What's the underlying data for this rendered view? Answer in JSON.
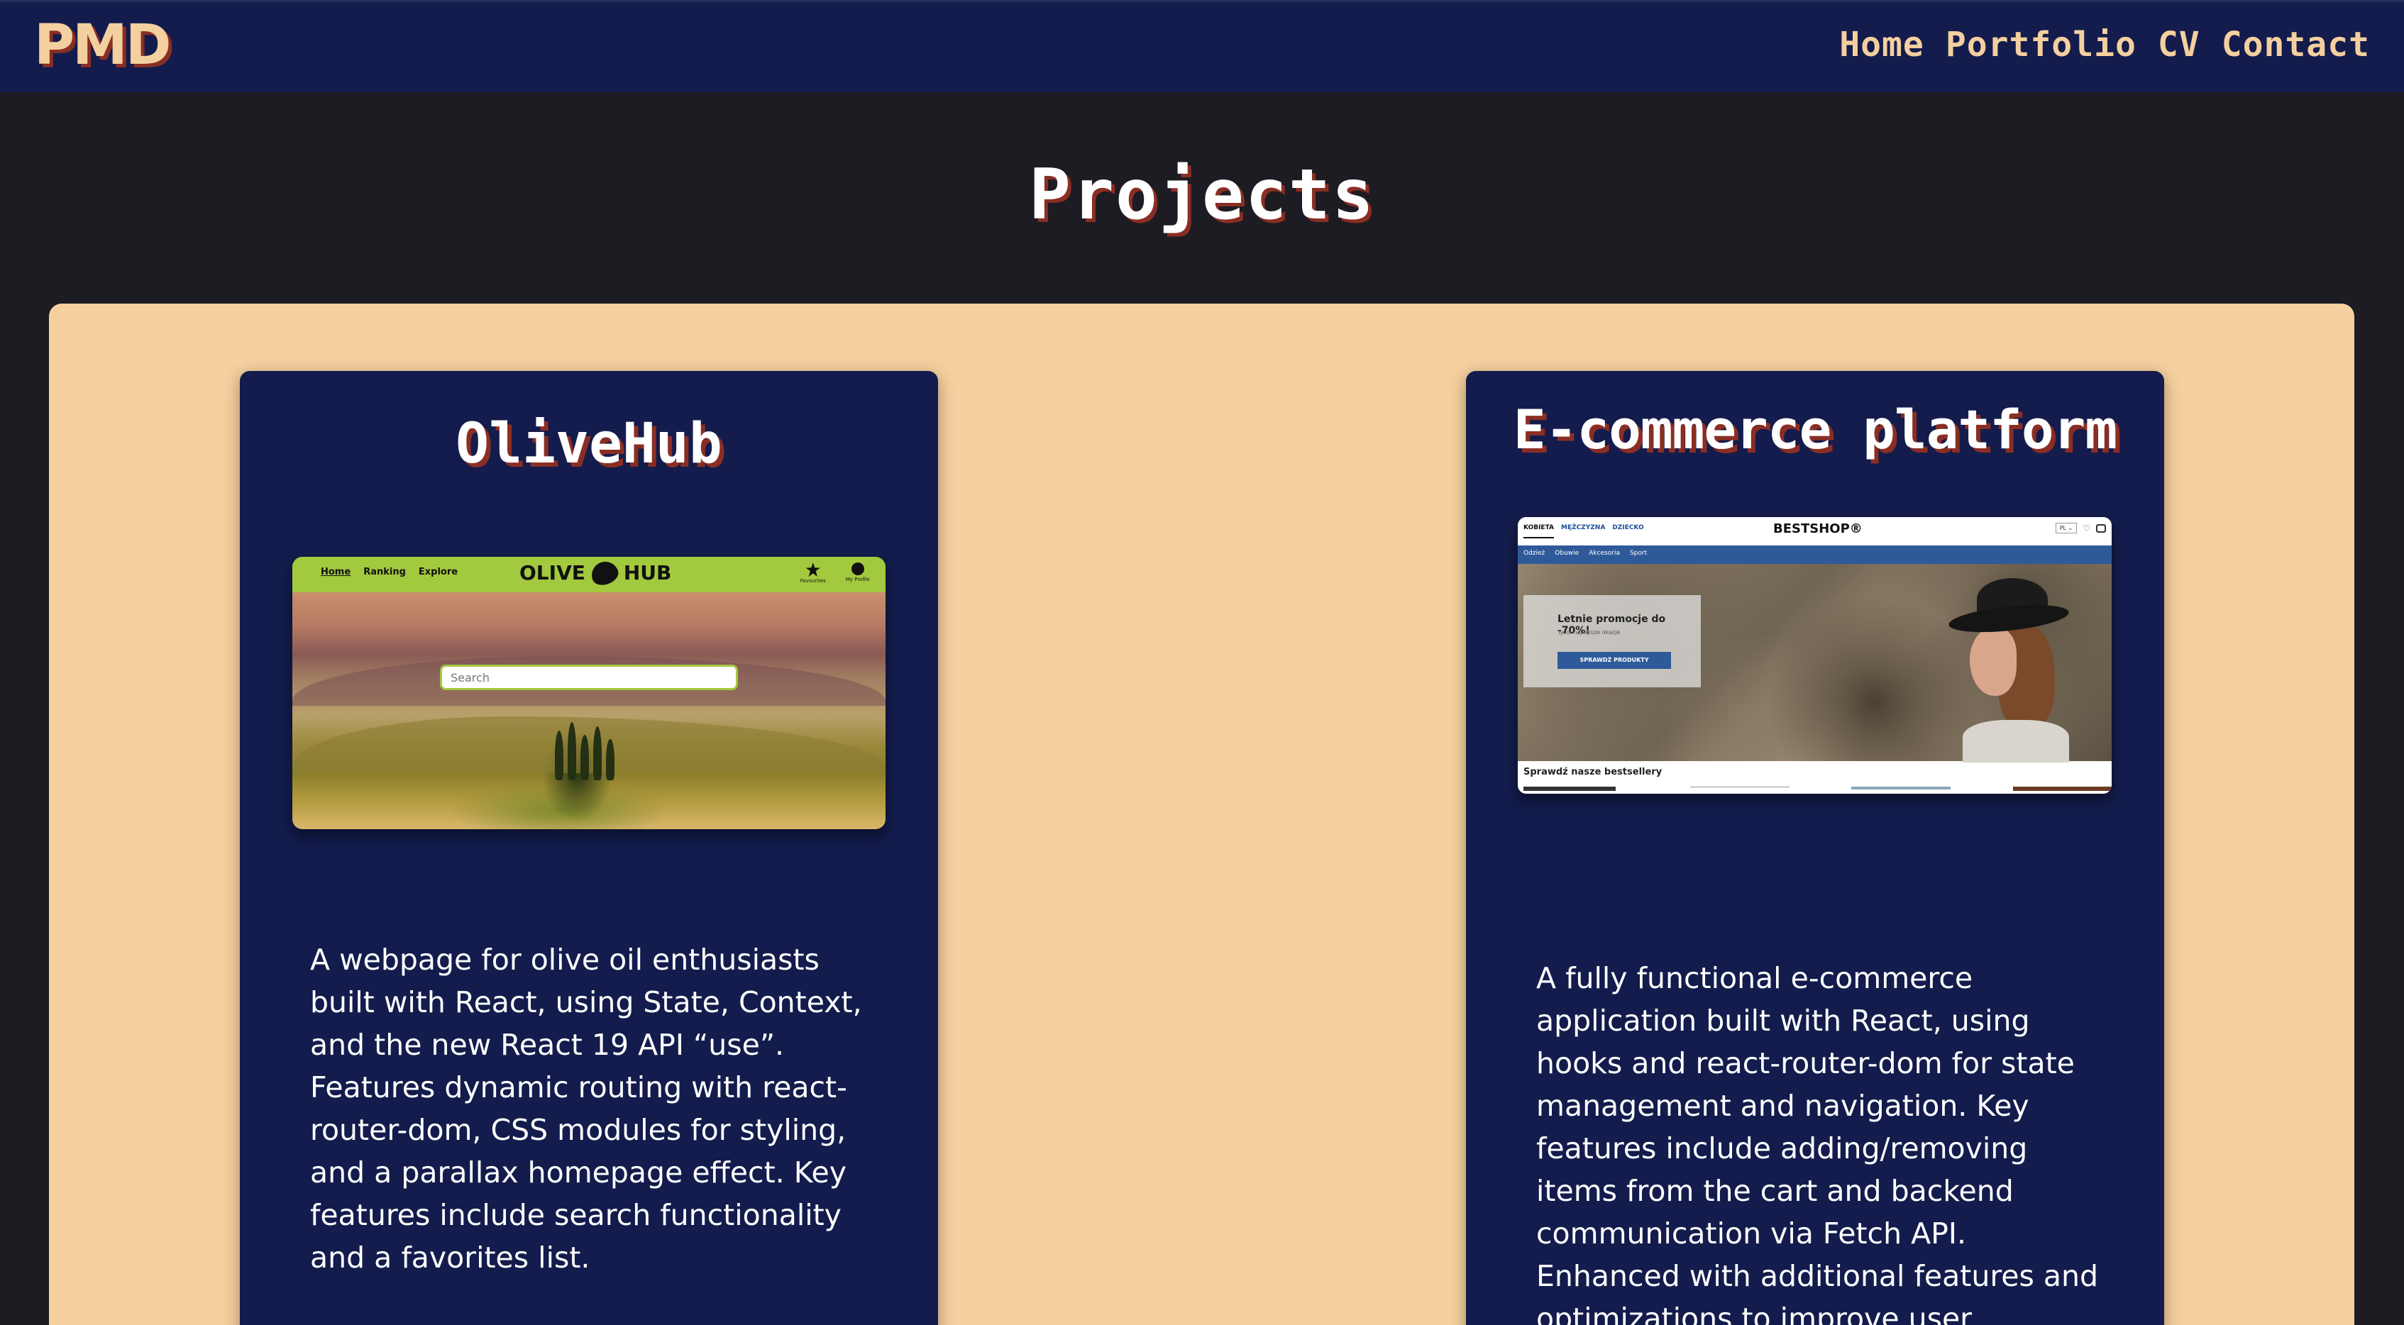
{
  "nav": {
    "logo": "PMD",
    "links": [
      "Home",
      "Portfolio",
      "CV",
      "Contact"
    ]
  },
  "page_title": "Projects",
  "projects": [
    {
      "title": "OliveHub",
      "description": "A webpage for olive oil enthusiasts built with React, using State, Context, and the new React 19 API “use”. Features dynamic routing with react-router-dom, CSS modules for styling, and a parallax homepage effect. Key features include search functionality and a favorites list.",
      "preview": {
        "nav_items": [
          "Home",
          "Ranking",
          "Explore"
        ],
        "logo_left": "OLIVE",
        "logo_right": "HUB",
        "icon_labels": [
          "Favourites",
          "My Profile"
        ],
        "search_placeholder": "Search",
        "bar_color": "#a3c93f"
      }
    },
    {
      "title": "E-commerce platform",
      "description": "A fully functional e-commerce application built with React, using hooks and react-router-dom for state management and navigation. Key features include adding/removing items from the cart and backend communication via Fetch API. Enhanced with additional features and optimizations to improve user experience.",
      "preview": {
        "tabs": [
          "KOBIETA",
          "MĘŻCZYZNA",
          "DZIECKO"
        ],
        "brand": "BESTSHOP®",
        "lang": "PL ⌄",
        "menu": [
          "Odzież",
          "Obuwie",
          "Akcesoria",
          "Sport"
        ],
        "promo_title": "Letnie promocje do -70%!",
        "promo_sub": "Tylko najlepsze okazje",
        "promo_button": "SPRAWDŹ PRODUKTY",
        "section_heading": "Sprawdź nasze bestsellery",
        "menu_color": "#2e5a9a"
      }
    }
  ],
  "colors": {
    "page_bg": "#1d1c22",
    "navy": "#131c4c",
    "peach": "#f6d09f",
    "accent_shadow": "#8a2e24"
  }
}
